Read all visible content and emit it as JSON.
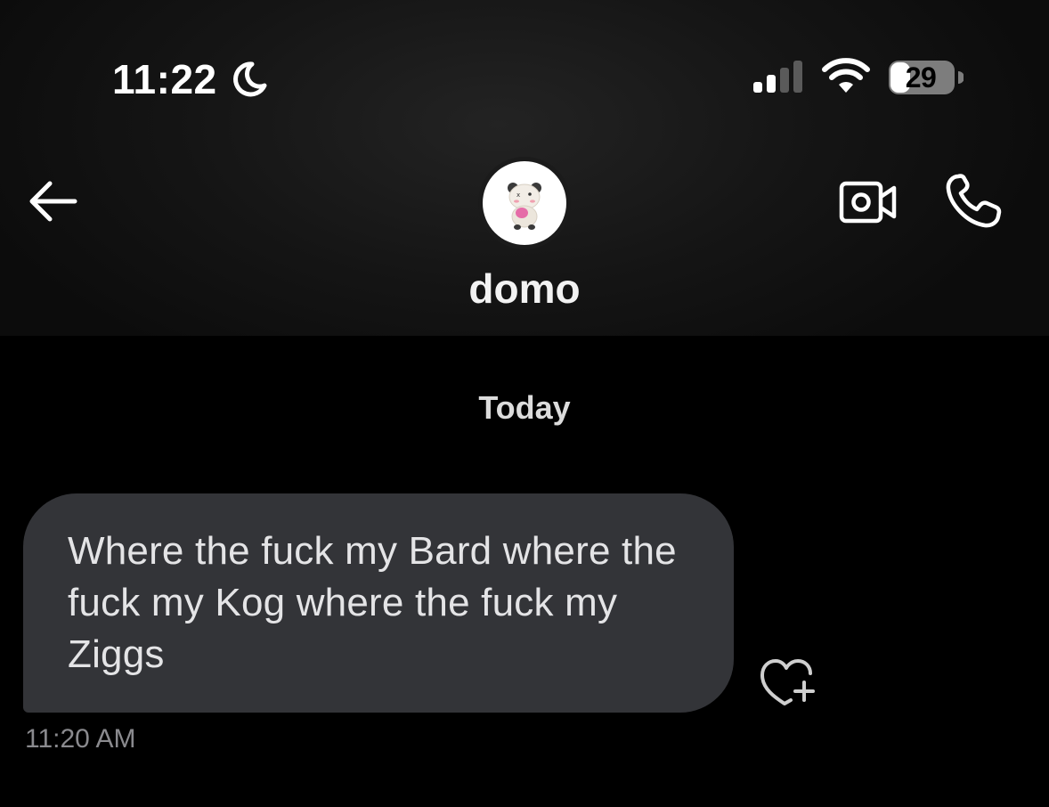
{
  "status_bar": {
    "time": "11:22",
    "battery_level": "29",
    "icons": [
      "moon-icon",
      "cellular-signal-icon",
      "wifi-icon",
      "battery-icon"
    ],
    "signal_bars_active": 2,
    "signal_bars_total": 4
  },
  "header": {
    "contact_name": "domo",
    "back_icon": "arrow-left-icon",
    "actions": [
      {
        "name": "video-call-button",
        "icon": "video-camera-icon"
      },
      {
        "name": "voice-call-button",
        "icon": "phone-icon"
      }
    ]
  },
  "conversation": {
    "date_separator": "Today",
    "messages": [
      {
        "text": "Where the fuck my Bard where the fuck my Kog where the fuck my Ziggs",
        "time": "11:20 AM",
        "direction": "incoming"
      }
    ],
    "reaction_icon": "heart-plus-icon"
  },
  "colors": {
    "background": "#000000",
    "header_background": "#151515",
    "bubble_incoming": "#333438",
    "text_primary": "#ffffff",
    "text_secondary": "#8a8a8e"
  }
}
